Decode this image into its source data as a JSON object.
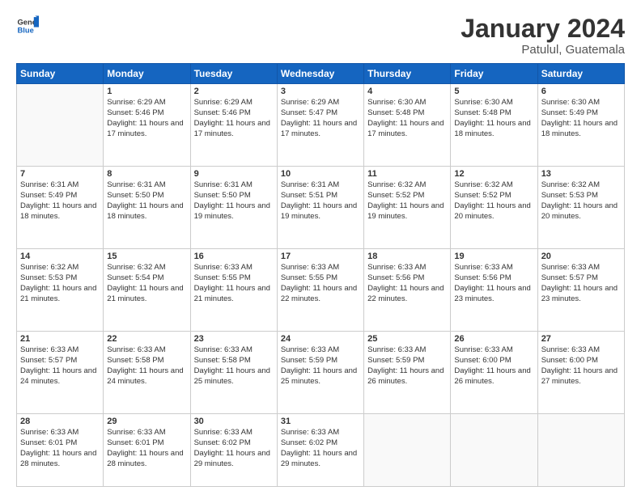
{
  "header": {
    "logo_general": "General",
    "logo_blue": "Blue",
    "month": "January 2024",
    "location": "Patulul, Guatemala"
  },
  "days_of_week": [
    "Sunday",
    "Monday",
    "Tuesday",
    "Wednesday",
    "Thursday",
    "Friday",
    "Saturday"
  ],
  "weeks": [
    [
      {
        "day": "",
        "empty": true
      },
      {
        "day": "1",
        "sunrise": "6:29 AM",
        "sunset": "5:46 PM",
        "daylight": "11 hours and 17 minutes."
      },
      {
        "day": "2",
        "sunrise": "6:29 AM",
        "sunset": "5:46 PM",
        "daylight": "11 hours and 17 minutes."
      },
      {
        "day": "3",
        "sunrise": "6:29 AM",
        "sunset": "5:47 PM",
        "daylight": "11 hours and 17 minutes."
      },
      {
        "day": "4",
        "sunrise": "6:30 AM",
        "sunset": "5:48 PM",
        "daylight": "11 hours and 17 minutes."
      },
      {
        "day": "5",
        "sunrise": "6:30 AM",
        "sunset": "5:48 PM",
        "daylight": "11 hours and 18 minutes."
      },
      {
        "day": "6",
        "sunrise": "6:30 AM",
        "sunset": "5:49 PM",
        "daylight": "11 hours and 18 minutes."
      }
    ],
    [
      {
        "day": "7",
        "sunrise": "6:31 AM",
        "sunset": "5:49 PM",
        "daylight": "11 hours and 18 minutes."
      },
      {
        "day": "8",
        "sunrise": "6:31 AM",
        "sunset": "5:50 PM",
        "daylight": "11 hours and 18 minutes."
      },
      {
        "day": "9",
        "sunrise": "6:31 AM",
        "sunset": "5:50 PM",
        "daylight": "11 hours and 19 minutes."
      },
      {
        "day": "10",
        "sunrise": "6:31 AM",
        "sunset": "5:51 PM",
        "daylight": "11 hours and 19 minutes."
      },
      {
        "day": "11",
        "sunrise": "6:32 AM",
        "sunset": "5:52 PM",
        "daylight": "11 hours and 19 minutes."
      },
      {
        "day": "12",
        "sunrise": "6:32 AM",
        "sunset": "5:52 PM",
        "daylight": "11 hours and 20 minutes."
      },
      {
        "day": "13",
        "sunrise": "6:32 AM",
        "sunset": "5:53 PM",
        "daylight": "11 hours and 20 minutes."
      }
    ],
    [
      {
        "day": "14",
        "sunrise": "6:32 AM",
        "sunset": "5:53 PM",
        "daylight": "11 hours and 21 minutes."
      },
      {
        "day": "15",
        "sunrise": "6:32 AM",
        "sunset": "5:54 PM",
        "daylight": "11 hours and 21 minutes."
      },
      {
        "day": "16",
        "sunrise": "6:33 AM",
        "sunset": "5:55 PM",
        "daylight": "11 hours and 21 minutes."
      },
      {
        "day": "17",
        "sunrise": "6:33 AM",
        "sunset": "5:55 PM",
        "daylight": "11 hours and 22 minutes."
      },
      {
        "day": "18",
        "sunrise": "6:33 AM",
        "sunset": "5:56 PM",
        "daylight": "11 hours and 22 minutes."
      },
      {
        "day": "19",
        "sunrise": "6:33 AM",
        "sunset": "5:56 PM",
        "daylight": "11 hours and 23 minutes."
      },
      {
        "day": "20",
        "sunrise": "6:33 AM",
        "sunset": "5:57 PM",
        "daylight": "11 hours and 23 minutes."
      }
    ],
    [
      {
        "day": "21",
        "sunrise": "6:33 AM",
        "sunset": "5:57 PM",
        "daylight": "11 hours and 24 minutes."
      },
      {
        "day": "22",
        "sunrise": "6:33 AM",
        "sunset": "5:58 PM",
        "daylight": "11 hours and 24 minutes."
      },
      {
        "day": "23",
        "sunrise": "6:33 AM",
        "sunset": "5:58 PM",
        "daylight": "11 hours and 25 minutes."
      },
      {
        "day": "24",
        "sunrise": "6:33 AM",
        "sunset": "5:59 PM",
        "daylight": "11 hours and 25 minutes."
      },
      {
        "day": "25",
        "sunrise": "6:33 AM",
        "sunset": "5:59 PM",
        "daylight": "11 hours and 26 minutes."
      },
      {
        "day": "26",
        "sunrise": "6:33 AM",
        "sunset": "6:00 PM",
        "daylight": "11 hours and 26 minutes."
      },
      {
        "day": "27",
        "sunrise": "6:33 AM",
        "sunset": "6:00 PM",
        "daylight": "11 hours and 27 minutes."
      }
    ],
    [
      {
        "day": "28",
        "sunrise": "6:33 AM",
        "sunset": "6:01 PM",
        "daylight": "11 hours and 28 minutes."
      },
      {
        "day": "29",
        "sunrise": "6:33 AM",
        "sunset": "6:01 PM",
        "daylight": "11 hours and 28 minutes."
      },
      {
        "day": "30",
        "sunrise": "6:33 AM",
        "sunset": "6:02 PM",
        "daylight": "11 hours and 29 minutes."
      },
      {
        "day": "31",
        "sunrise": "6:33 AM",
        "sunset": "6:02 PM",
        "daylight": "11 hours and 29 minutes."
      },
      {
        "day": "",
        "empty": true
      },
      {
        "day": "",
        "empty": true
      },
      {
        "day": "",
        "empty": true
      }
    ]
  ]
}
